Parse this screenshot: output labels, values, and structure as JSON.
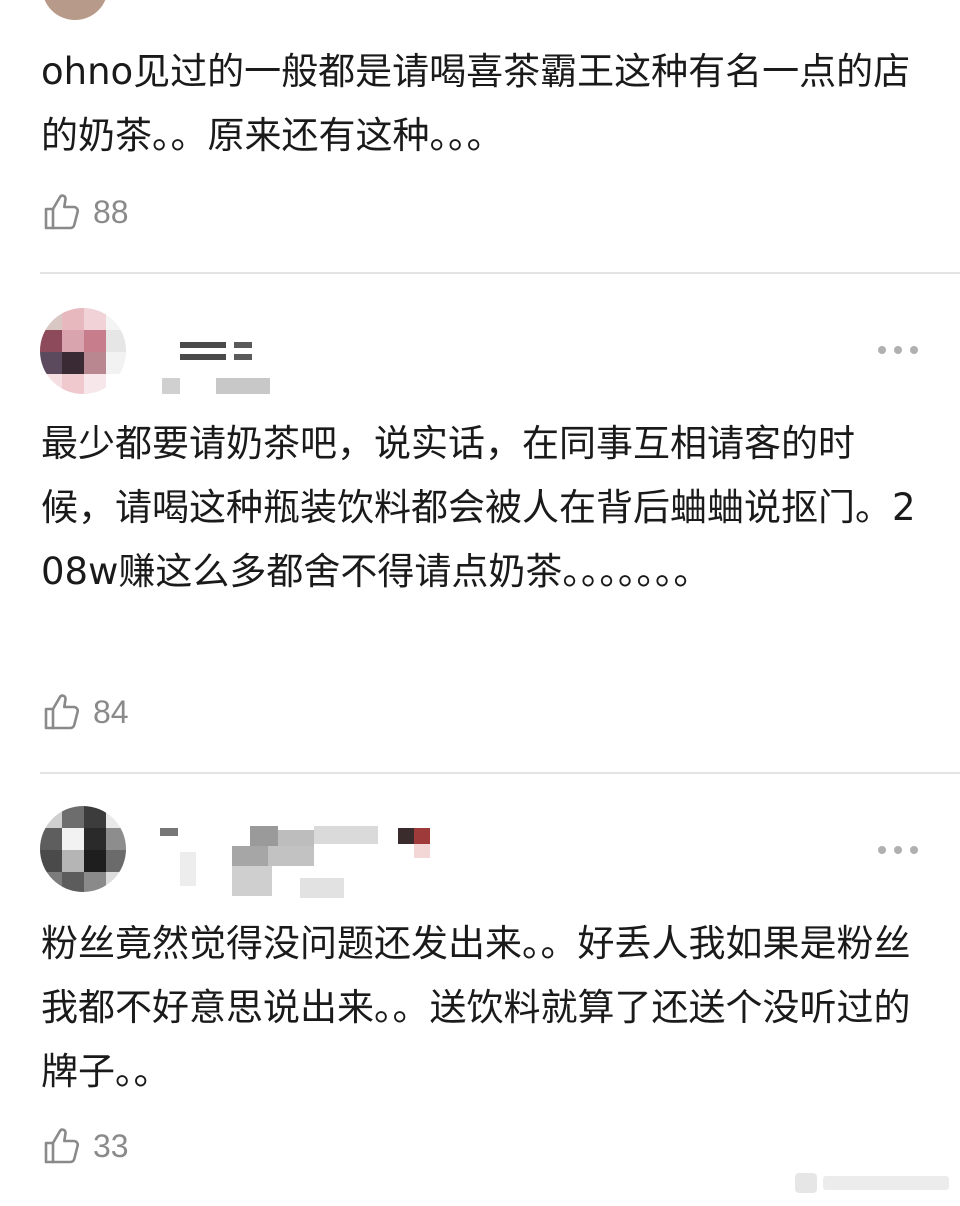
{
  "comments": [
    {
      "text": "ohno见过的一般都是请喝喜茶霸王这种有名一点的店的奶茶。。原来还有这种。。。",
      "likes": "88"
    },
    {
      "text": "最少都要请奶茶吧，说实话，在同事互相请客的时候，请喝这种瓶装饮料都会被人在背后蛐蛐说抠门。208w赚这么多都舍不得请点奶茶。。。。。。。",
      "likes": "84"
    },
    {
      "text": "粉丝竟然觉得没问题还发出来。。好丢人我如果是粉丝我都不好意思说出来。。送饮料就算了还送个没听过的牌子。。",
      "likes": "33"
    }
  ],
  "icons": {
    "like": "thumbs-up-icon",
    "more": "more-dots-icon"
  },
  "colors": {
    "text": "#1a1a1a",
    "muted": "#8a8a8a",
    "divider": "#e4e4e4",
    "dots": "#b0b0b0"
  }
}
